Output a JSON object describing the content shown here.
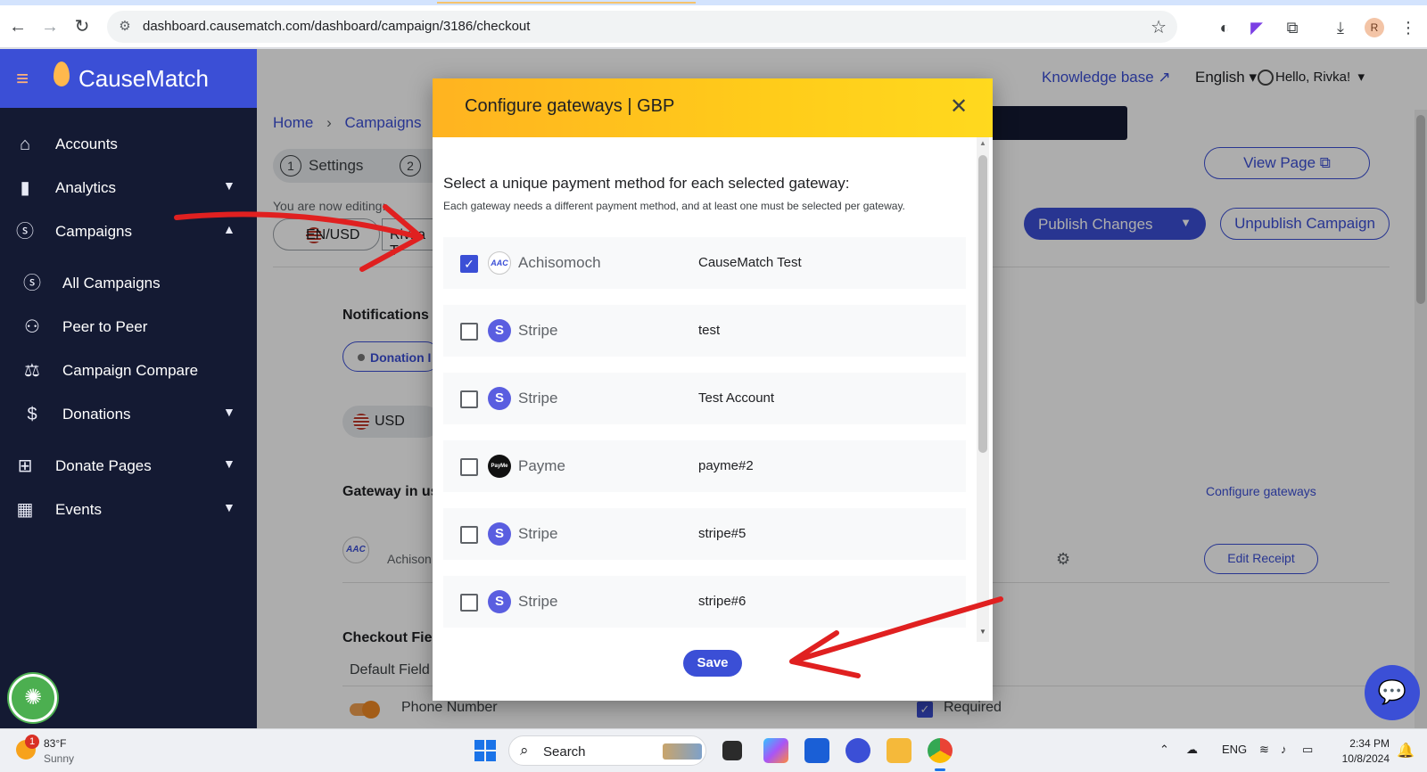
{
  "browser": {
    "url": "dashboard.causematch.com/dashboard/campaign/3186/checkout"
  },
  "sidebar": {
    "brand": "CauseMatch",
    "items": [
      {
        "label": "Accounts",
        "icon": "bank-icon"
      },
      {
        "label": "Analytics",
        "icon": "bar-chart-icon"
      },
      {
        "label": "Campaigns",
        "icon": "dollar-circle-icon"
      },
      {
        "label": "All Campaigns",
        "icon": "dollar-circle-icon"
      },
      {
        "label": "Peer to Peer",
        "icon": "people-icon"
      },
      {
        "label": "Campaign Compare",
        "icon": "scale-icon"
      },
      {
        "label": "Donations",
        "icon": "dollar-icon"
      },
      {
        "label": "Donate Pages",
        "icon": "grid-icon"
      },
      {
        "label": "Events",
        "icon": "calendar-icon"
      }
    ]
  },
  "header": {
    "knowledge_base": "Knowledge base ↗",
    "language": "English",
    "greeting": "Hello, Rivka!"
  },
  "page": {
    "breadcrumb_home": "Home",
    "breadcrumb_campaigns": "Campaigns",
    "step1_num": "1",
    "step1_label": "Settings",
    "step2_num": "2",
    "editing_label": "You are now editing:",
    "locale": "EN/USD",
    "editor_name": "Rivka T",
    "view_page": "View Page",
    "publish": "Publish Changes",
    "unpublish": "Unpublish Campaign",
    "notifications_heading": "Notifications",
    "donation_chip": "Donation I",
    "currency_chip": "USD",
    "gateway_heading": "Gateway in us",
    "configure_gateways": "Configure gateways",
    "gateway_logo": "AAC",
    "gateway_name": "Achison",
    "edit_receipt": "Edit Receipt",
    "checkout_heading": "Checkout Fiel",
    "default_fields": "Default Field",
    "phone_number": "Phone Number",
    "required": "Required"
  },
  "modal": {
    "title": "Configure gateways | GBP",
    "instruction": "Select a unique payment method for each selected gateway:",
    "subtext": "Each gateway needs a different payment method, and at least one must be selected per gateway.",
    "gateways": [
      {
        "checked": true,
        "type": "aac",
        "logo": "AAC",
        "name": "Achisomoch",
        "account": "CauseMatch Test"
      },
      {
        "checked": false,
        "type": "stripe",
        "logo": "S",
        "name": "Stripe",
        "account": "test"
      },
      {
        "checked": false,
        "type": "stripe",
        "logo": "S",
        "name": "Stripe",
        "account": "Test Account"
      },
      {
        "checked": false,
        "type": "payme",
        "logo": "PayMe",
        "name": "Payme",
        "account": "payme#2"
      },
      {
        "checked": false,
        "type": "stripe",
        "logo": "S",
        "name": "Stripe",
        "account": "stripe#5"
      },
      {
        "checked": false,
        "type": "stripe",
        "logo": "S",
        "name": "Stripe",
        "account": "stripe#6"
      }
    ],
    "save": "Save"
  },
  "taskbar": {
    "weather_badge": "1",
    "temperature": "83°F",
    "condition": "Sunny",
    "search": "Search",
    "lang": "ENG",
    "time": "2:34 PM",
    "date": "10/8/2024"
  },
  "colors": {
    "brand_blue": "#3b4fd6",
    "sidebar_dark": "#141a33",
    "modal_header": "#ffc61a",
    "annotation_red": "#e02020"
  }
}
